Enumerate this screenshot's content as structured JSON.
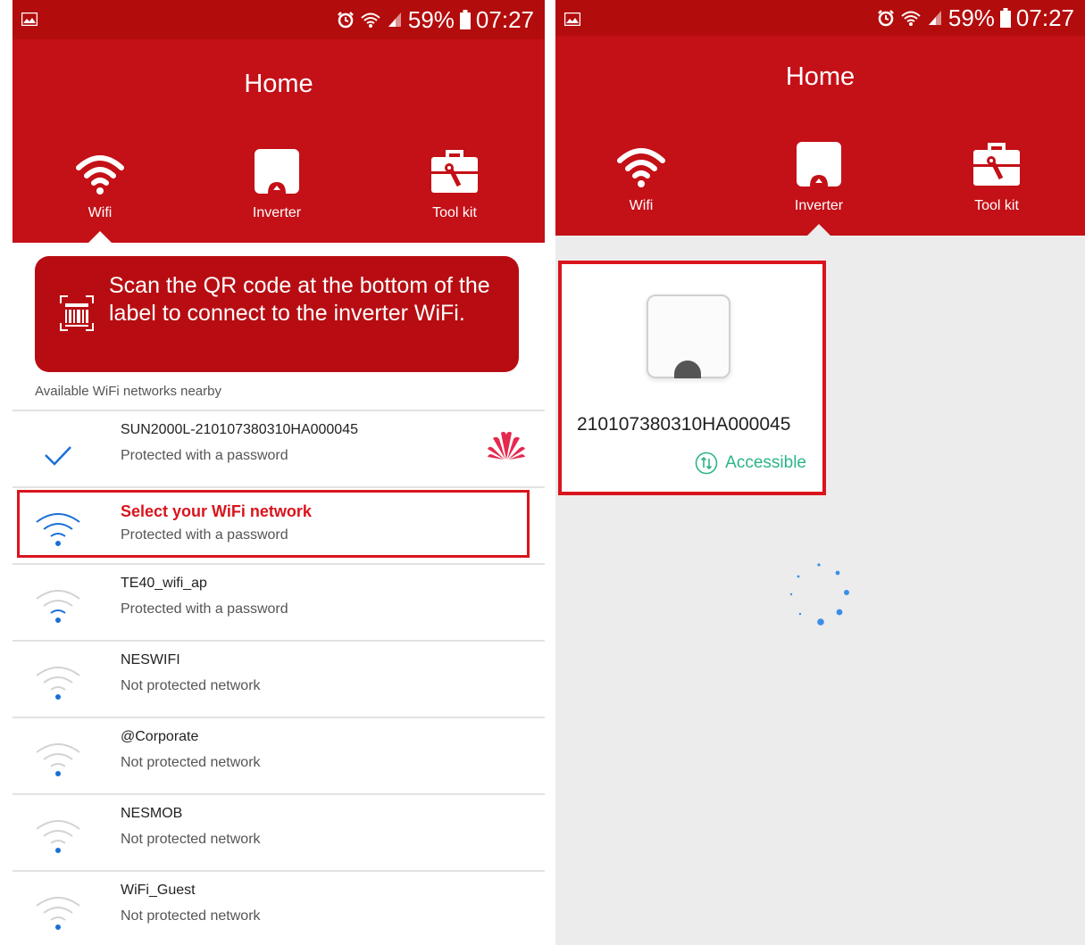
{
  "status_bar": {
    "battery": "59%",
    "time": "07:27"
  },
  "left_screen": {
    "title": "Home",
    "tabs": [
      {
        "label": "Wifi"
      },
      {
        "label": "Inverter"
      },
      {
        "label": "Tool kit"
      }
    ],
    "active_tab": "Wifi",
    "qr_banner_text": "Scan the QR code at the bottom of the label to connect to the inverter WiFi.",
    "networks_heading": "Available WiFi networks nearby",
    "networks": [
      {
        "ssid": "SUN2000L-210107380310HA000045",
        "status": "Protected with a password",
        "connected": true
      },
      {
        "ssid": "Select your WiFi network",
        "status": "Protected with a password",
        "highlighted": true
      },
      {
        "ssid": "TE40_wifi_ap",
        "status": "Protected with a password"
      },
      {
        "ssid": "NESWIFI",
        "status": "Not protected network"
      },
      {
        "ssid": "@Corporate",
        "status": "Not protected network"
      },
      {
        "ssid": "NESMOB",
        "status": "Not protected network"
      },
      {
        "ssid": "WiFi_Guest",
        "status": "Not protected network"
      }
    ]
  },
  "right_screen": {
    "title": "Home",
    "tabs": [
      {
        "label": "Wifi"
      },
      {
        "label": "Inverter"
      },
      {
        "label": "Tool kit"
      }
    ],
    "active_tab": "Inverter",
    "inverter": {
      "serial": "210107380310HA000045",
      "status": "Accessible"
    },
    "loading": true
  },
  "icons": {
    "status_bar": [
      "gallery-icon",
      "alarm-icon",
      "wifi-signal-icon",
      "cell-signal-icon",
      "battery-icon"
    ],
    "tabs": [
      "wifi-icon",
      "inverter-icon",
      "toolkit-icon"
    ],
    "qr": "qr-code-icon",
    "connected": "check-icon",
    "brand": "huawei-logo"
  },
  "colors": {
    "primary": "#c41017",
    "highlight": "#d9141c",
    "accessible": "#2bb58a",
    "wifi_active": "#1a6fd6",
    "wifi_inactive": "#cfcfcf"
  }
}
